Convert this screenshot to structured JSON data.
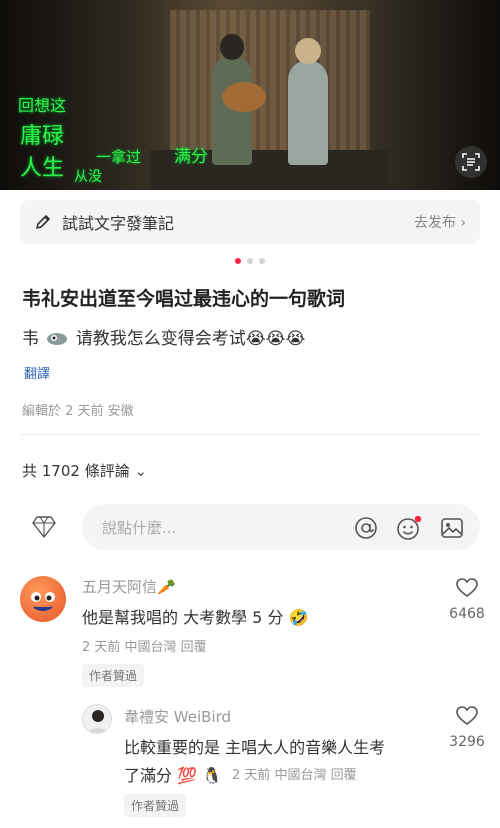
{
  "hero": {
    "lyrics": [
      "回想这",
      "庸碌",
      "人生",
      "从没",
      "一拿过",
      "满分"
    ]
  },
  "note_bar": {
    "label": "試試文字發筆記",
    "publish": "去发布 ›"
  },
  "post": {
    "title": "韦礼安出道至今唱过最违心的一句歌词",
    "body_prefix": "韦",
    "body_text": "请教我怎么变得会考试😭😭😭",
    "translate": "翻譯",
    "meta": "編輯於 2 天前 安徽"
  },
  "comments_header": {
    "count": "共 1702 條評論",
    "chevron": "⌄"
  },
  "comment_input": {
    "placeholder": "說點什麼..."
  },
  "comments": [
    {
      "name": "五月天阿信🥕",
      "text": "他是幫我唱的  大考數學 5 分 🤣",
      "meta": "2 天前 中國台灣  回覆",
      "likes": "6468",
      "tag": "作者贊過"
    },
    {
      "name": "韋禮安 WeiBird",
      "text_line1": "比較重要的是 主唱大人的音樂人生考",
      "text_line2": "了滿分 💯 🐧",
      "meta": "2 天前 中國台灣  回覆",
      "likes": "3296",
      "tag": "作者贊過"
    }
  ],
  "colors": {
    "accent": "#ff2442",
    "link": "#2a62b0",
    "lyric": "#2ef04a"
  }
}
